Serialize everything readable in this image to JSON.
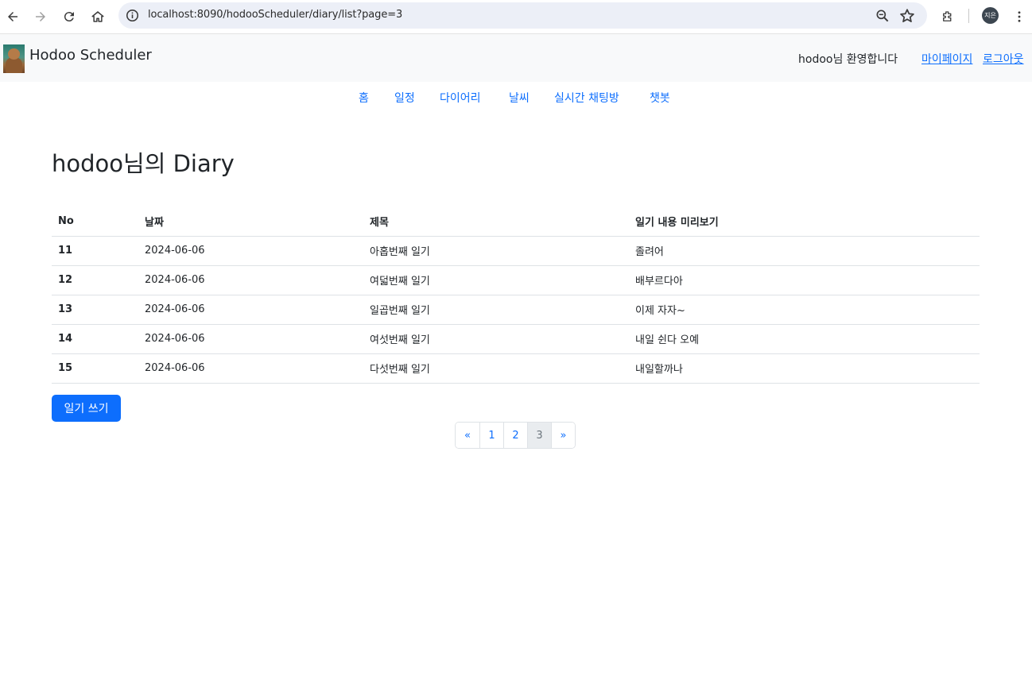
{
  "browser": {
    "url": "localhost:8090/hodooScheduler/diary/list?page=3",
    "avatar_text": "지은"
  },
  "navbar": {
    "brand": "Hodoo Scheduler",
    "welcome": "hodoo님 환영합니다",
    "mypage": "마이페이지",
    "logout": "로그아웃"
  },
  "menu": {
    "items": [
      "홈",
      "일정",
      "다이어리",
      "날씨",
      "실시간 채팅방",
      "챗봇"
    ]
  },
  "page": {
    "title": "hodoo님의 Diary"
  },
  "table": {
    "headers": [
      "No",
      "날짜",
      "제목",
      "일기 내용 미리보기"
    ],
    "rows": [
      {
        "no": "11",
        "date": "2024-06-06",
        "title": "아홉번째 일기",
        "preview": "졸려어"
      },
      {
        "no": "12",
        "date": "2024-06-06",
        "title": "여덟번째 일기",
        "preview": "배부르다아"
      },
      {
        "no": "13",
        "date": "2024-06-06",
        "title": "일곱번째 일기",
        "preview": "이제 자자~"
      },
      {
        "no": "14",
        "date": "2024-06-06",
        "title": "여섯번째 일기",
        "preview": "내일 쉰다 오예"
      },
      {
        "no": "15",
        "date": "2024-06-06",
        "title": "다섯번째 일기",
        "preview": "내일할까나"
      }
    ]
  },
  "actions": {
    "write_label": "일기 쓰기"
  },
  "pagination": {
    "items": [
      "«",
      "1",
      "2",
      "3",
      "»"
    ],
    "active_page": "3"
  },
  "colors": {
    "primary": "#0d6efd",
    "navbar_bg": "#f8f9fa",
    "active_page_bg": "#e9ecef"
  }
}
